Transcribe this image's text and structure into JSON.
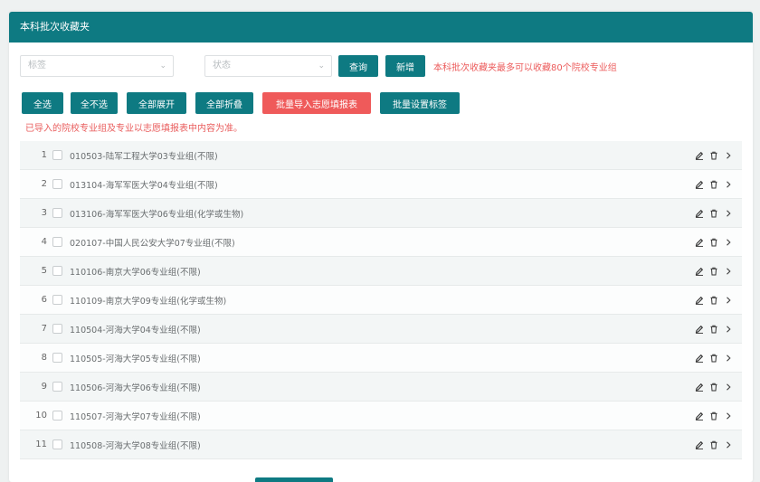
{
  "header": {
    "title": "本科批次收藏夹"
  },
  "filters": {
    "tag_placeholder": "标签",
    "status_placeholder": "状态",
    "query_label": "查询",
    "add_label": "新增",
    "limit_note": "本科批次收藏夹最多可以收藏80个院校专业组"
  },
  "toolbar": {
    "select_all": "全选",
    "select_none": "全不选",
    "expand_all": "全部展开",
    "collapse_all": "全部折叠",
    "batch_import": "批量导入志愿填报表",
    "batch_tag": "批量设置标签"
  },
  "hint": "已导入的院校专业组及专业以志愿填报表中内容为准。",
  "items": [
    {
      "num": "1",
      "text": "010503-陆军工程大学03专业组(不限)"
    },
    {
      "num": "2",
      "text": "013104-海军军医大学04专业组(不限)"
    },
    {
      "num": "3",
      "text": "013106-海军军医大学06专业组(化学或生物)"
    },
    {
      "num": "4",
      "text": "020107-中国人民公安大学07专业组(不限)"
    },
    {
      "num": "5",
      "text": "110106-南京大学06专业组(不限)"
    },
    {
      "num": "6",
      "text": "110109-南京大学09专业组(化学或生物)"
    },
    {
      "num": "7",
      "text": "110504-河海大学04专业组(不限)"
    },
    {
      "num": "8",
      "text": "110505-河海大学05专业组(不限)"
    },
    {
      "num": "9",
      "text": "110506-河海大学06专业组(不限)"
    },
    {
      "num": "10",
      "text": "110507-河海大学07专业组(不限)"
    },
    {
      "num": "11",
      "text": "110508-河海大学08专业组(不限)"
    }
  ],
  "colors": {
    "primary": "#0e7a82",
    "danger": "#ef5a5a"
  }
}
